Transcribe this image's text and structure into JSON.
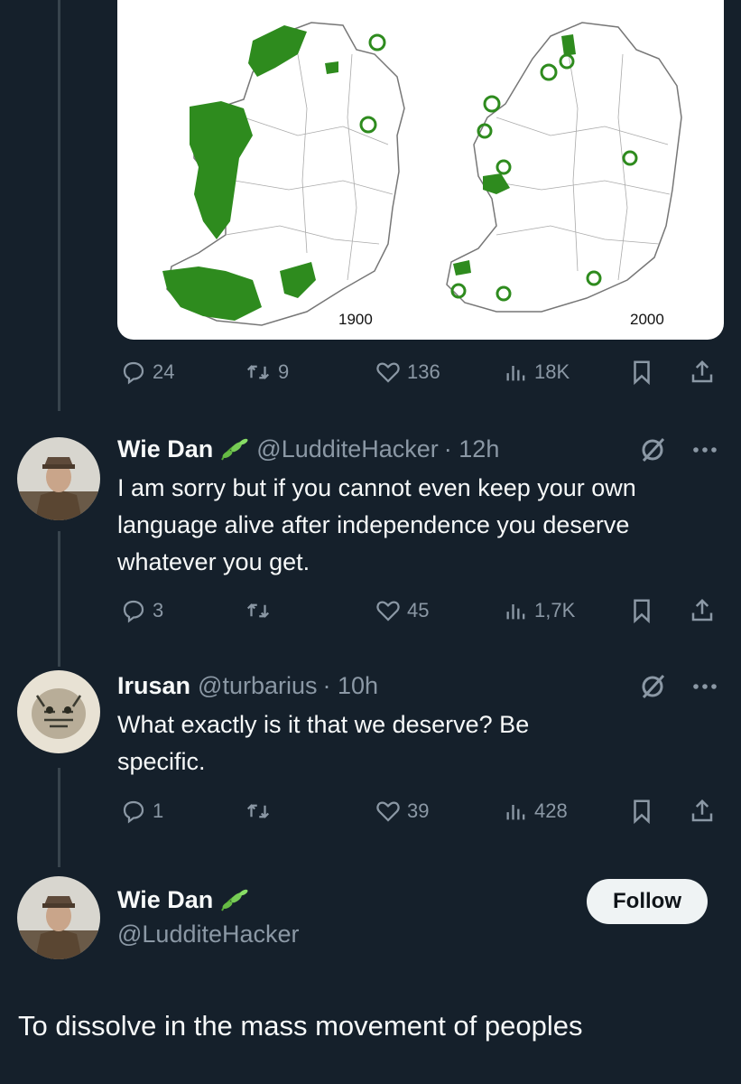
{
  "map_card": {
    "label_left": "1900",
    "label_right": "2000"
  },
  "original_tweet_actions": {
    "replies": "24",
    "reposts": "9",
    "likes": "136",
    "views": "18K"
  },
  "replies": [
    {
      "name": "Wie Dan",
      "handle": "@LudditeHacker",
      "time": "· 12h",
      "text": "I am sorry but if you cannot even keep your own language alive after independence you deserve whatever you get.",
      "actions": {
        "replies": "3",
        "reposts": "",
        "likes": "45",
        "views": "1,7K"
      }
    },
    {
      "name": "Irusan",
      "handle": "@turbarius",
      "time": "· 10h",
      "text": "What exactly is it that we deserve? Be specific.",
      "actions": {
        "replies": "1",
        "reposts": "",
        "likes": "39",
        "views": "428"
      }
    }
  ],
  "main_tweet": {
    "name": "Wie Dan",
    "handle": "@LudditeHacker",
    "follow_label": "Follow",
    "text": "To dissolve in the mass movement of peoples"
  },
  "colors": {
    "background": "#15202b",
    "text": "#f7f9f9",
    "muted": "#8b98a5",
    "thread_line": "#38444d",
    "map_green": "#2e8b1e"
  },
  "icons": [
    "reply-icon",
    "repost-icon",
    "like-icon",
    "views-icon",
    "bookmark-icon",
    "share-icon",
    "mute-icon",
    "more-icon",
    "leaf-emoji-icon"
  ]
}
